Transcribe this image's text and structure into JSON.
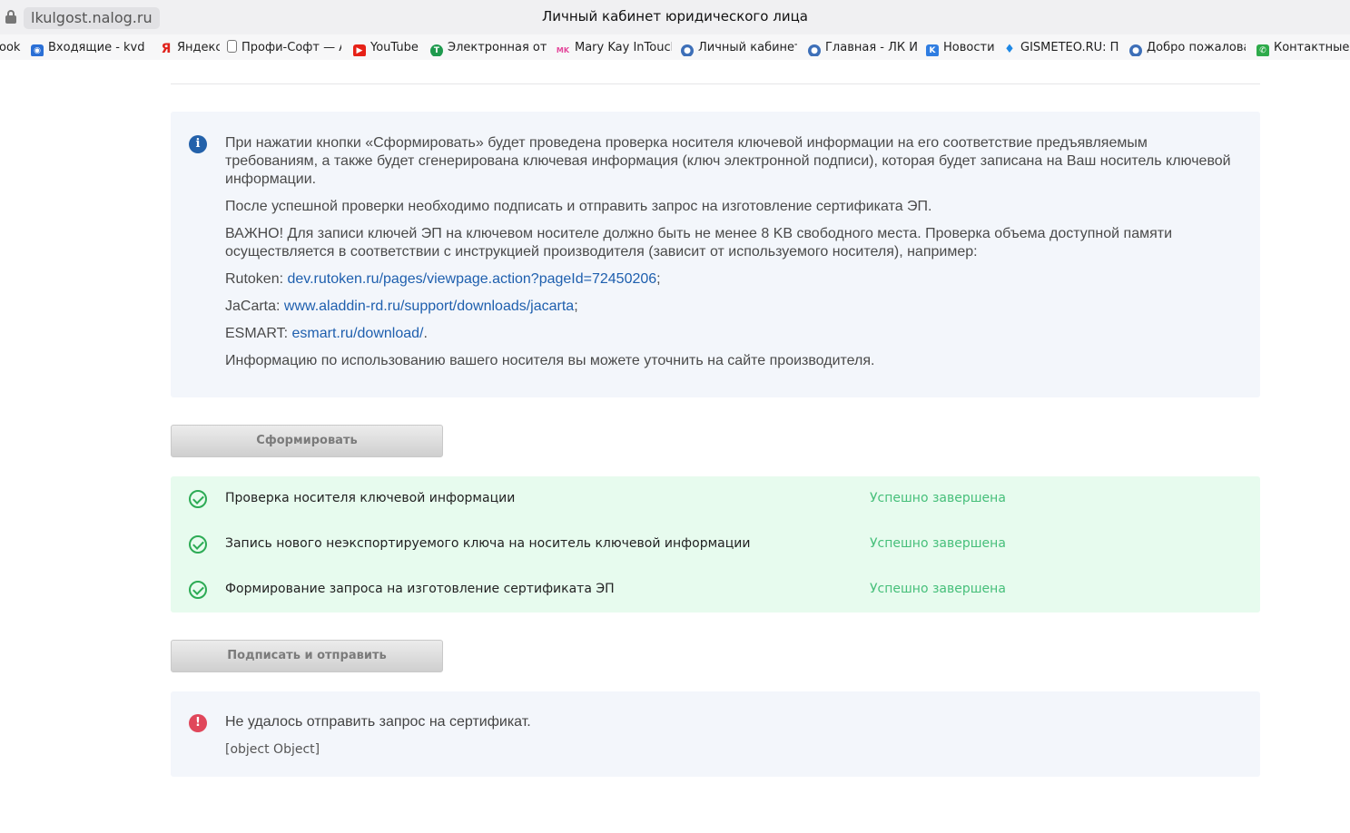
{
  "browser": {
    "url": "lkulgost.nalog.ru",
    "page_title": "Личный кабинет юридического лица"
  },
  "bookmarks": [
    {
      "label": "ook",
      "icon": "none",
      "color": ""
    },
    {
      "label": "Входящие - kvden",
      "icon": "mail-icon",
      "color": "#2a6fd6"
    },
    {
      "label": "Яндекс",
      "icon": "yandex-icon",
      "color": "#e0221b"
    },
    {
      "label": "Профи-Софт — АИ",
      "icon": "document-icon",
      "color": "#777777"
    },
    {
      "label": "YouTube",
      "icon": "youtube-icon",
      "color": "#e62117"
    },
    {
      "label": "Электронная отпр",
      "icon": "tensor-icon",
      "color": "#1f9a4e"
    },
    {
      "label": "Mary Kay InTouch",
      "icon": "marykay-icon",
      "color": "#e4479b"
    },
    {
      "label": "Личный кабинет ю",
      "icon": "nalog-icon",
      "color": "#3d6fb8"
    },
    {
      "label": "Главная - ЛК ИП",
      "icon": "nalog-icon",
      "color": "#3d6fb8"
    },
    {
      "label": "Новости",
      "icon": "vk-icon",
      "color": "#2f7de1"
    },
    {
      "label": "GISMETEO.RU: Пог",
      "icon": "gismeteo-icon",
      "color": "#1e88e5"
    },
    {
      "label": "Добро пожаловат",
      "icon": "nalog-icon",
      "color": "#3d6fb8"
    },
    {
      "label": "Контактные л",
      "icon": "contacts-icon",
      "color": "#2eaa4a"
    }
  ],
  "info": {
    "p1": "При нажатии кнопки «Сформировать» будет проведена проверка носителя ключевой информации на его соответствие предъявляемым требованиям, а также будет сгенерирована ключевая информация (ключ электронной подписи), которая будет записана на Ваш носитель ключевой информации.",
    "p2": "После успешной проверки необходимо подписать и отправить запрос на изготовление сертификата ЭП.",
    "p3": "ВАЖНО! Для записи ключей ЭП на ключевом носителе должно быть не менее 8 KB свободного места. Проверка объема доступной памяти осуществляется в соответствии с инструкцией производителя (зависит от используемого носителя), например:",
    "rutoken_prefix": "Rutoken: ",
    "rutoken_link": "dev.rutoken.ru/pages/viewpage.action?pageId=72450206",
    "rutoken_suffix": ";",
    "jacarta_prefix": "JaCarta: ",
    "jacarta_link": "www.aladdin-rd.ru/support/downloads/jacarta",
    "jacarta_suffix": ";",
    "esmart_prefix": "ESMART: ",
    "esmart_link": "esmart.ru/download/",
    "esmart_suffix": ".",
    "p4": "Информацию по использованию вашего носителя вы можете уточнить на сайте производителя."
  },
  "buttons": {
    "form_label": "Сформировать",
    "sign_label": "Подписать и отправить"
  },
  "steps": [
    {
      "label": "Проверка носителя ключевой информации",
      "status": "Успешно завершена"
    },
    {
      "label": "Запись нового неэкспортируемого ключа на носитель ключевой информации",
      "status": "Успешно завершена"
    },
    {
      "label": "Формирование запроса на изготовление сертификата ЭП",
      "status": "Успешно завершена"
    }
  ],
  "error": {
    "title": "Не удалось отправить запрос на сертификат.",
    "detail": "[object Object]"
  },
  "colors": {
    "info_bg": "#f3f6fb",
    "success_bg": "#e7fbee",
    "success_text": "#46bf7a",
    "link": "#1e5fae",
    "error_icon": "#e0475b",
    "info_icon": "#2361aa"
  }
}
